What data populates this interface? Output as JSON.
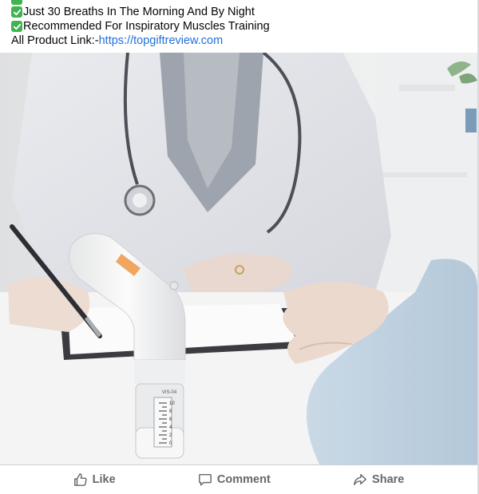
{
  "post": {
    "lines": [
      {
        "check": true,
        "text": "Just 30 Breaths In The Morning And By Night"
      },
      {
        "check": true,
        "text": "Recommended For Inspiratory Muscles Training"
      }
    ],
    "link_prefix": "All Product Link:-",
    "link_url": "https://topgiftreview.com"
  },
  "photo": {
    "device_label": "VIS-04",
    "scale_numbers": [
      "10",
      "8",
      "6",
      "4",
      "2",
      "0"
    ]
  },
  "actions": {
    "like": "Like",
    "comment": "Comment",
    "share": "Share"
  },
  "colors": {
    "check_green": "#3fb34f",
    "link_blue": "#216fdb",
    "action_gray": "#65676b"
  }
}
